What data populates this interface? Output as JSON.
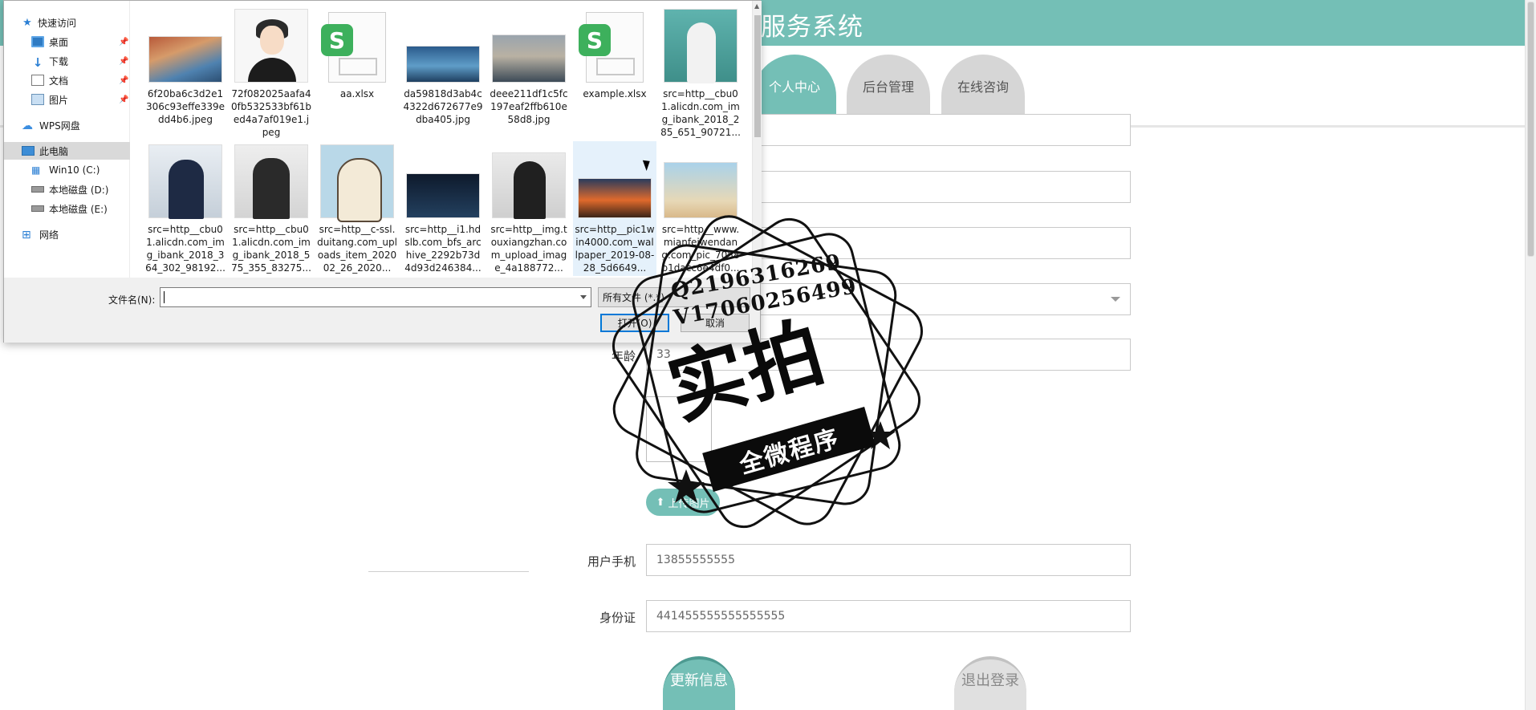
{
  "page": {
    "header_title": "服务系统",
    "nav_tabs": [
      {
        "label": "个人中心",
        "active": true
      },
      {
        "label": "后台管理",
        "active": false
      },
      {
        "label": "在线咨询",
        "active": false
      }
    ],
    "form": {
      "age_label": "年龄",
      "age_value": "33",
      "upload_button": "上传图片",
      "phone_label": "用户手机",
      "phone_value": "13855555555",
      "idcard_label": "身份证",
      "idcard_value": "441455555555555555"
    },
    "actions": {
      "update": "更新信息",
      "logout": "退出登录"
    },
    "colors": {
      "accent": "#74bfb6",
      "accent_dark": "#4d9a91"
    }
  },
  "dialog": {
    "nav_items": [
      {
        "label": "快速访问",
        "icon": "star-icon"
      },
      {
        "label": "桌面",
        "icon": "desktop-icon",
        "pinned": true
      },
      {
        "label": "下载",
        "icon": "download-icon",
        "pinned": true
      },
      {
        "label": "文档",
        "icon": "document-icon",
        "pinned": true
      },
      {
        "label": "图片",
        "icon": "picture-icon",
        "pinned": true
      },
      {
        "label": "WPS网盘",
        "icon": "cloud-icon"
      },
      {
        "label": "此电脑",
        "icon": "computer-icon",
        "selected": true
      },
      {
        "label": "Win10 (C:)",
        "icon": "windows-drive-icon"
      },
      {
        "label": "本地磁盘 (D:)",
        "icon": "drive-icon"
      },
      {
        "label": "本地磁盘 (E:)",
        "icon": "drive-icon"
      },
      {
        "label": "网络",
        "icon": "network-icon"
      }
    ],
    "files": [
      {
        "name": "6f20ba6c3d2e1306c93effe339edd4b6.jpeg",
        "thumb": "landscape"
      },
      {
        "name": "72f082025aafa40fb532533bf61bed4a7af019e1.jpeg",
        "thumb": "avatar"
      },
      {
        "name": "aa.xlsx",
        "thumb": "xlsx"
      },
      {
        "name": "da59818d3ab4c4322d672677e9dba405.jpg",
        "thumb": "boat"
      },
      {
        "name": "deee211df1c5fc197eaf2ffb610e58d8.jpg",
        "thumb": "sunset"
      },
      {
        "name": "example.xlsx",
        "thumb": "xlsx"
      },
      {
        "name": "src=http__cbu01.alicdn.com_img_ibank_2018_285_651_90721...",
        "thumb": "woman1"
      },
      {
        "name": "src=http__cbu01.alicdn.com_img_ibank_2018_364_302_98192...",
        "thumb": "suit1"
      },
      {
        "name": "src=http__cbu01.alicdn.com_img_ibank_2018_575_355_83275...",
        "thumb": "suit2"
      },
      {
        "name": "src=http__c-ssl.duitang.com_uploads_item_202002_26_2020...",
        "thumb": "cartoon"
      },
      {
        "name": "src=http__i1.hdslb.com_bfs_archive_2292b73d4d93d246384...",
        "thumb": "dance"
      },
      {
        "name": "src=http__img.touxiangzhan.com_upload_image_4a188772...",
        "thumb": "man"
      },
      {
        "name": "src=http__pic1win4000.com_wallpaper_2019-08-28_5d6649...",
        "thumb": "sunset2",
        "hovered": true
      },
      {
        "name": "src=http__www.mianfeiwendang.com_pic_7058b1dacc6e4df0...",
        "thumb": "beach"
      }
    ],
    "filename_label": "文件名(N):",
    "filename_value": "",
    "filetype_value": "所有文件 (*.*)",
    "open_button": "打开(O)",
    "cancel_button": "取消"
  },
  "watermark": {
    "qq": "Q2196316269",
    "v": "V17060256499",
    "main": "实拍",
    "sub": "全微程序"
  }
}
